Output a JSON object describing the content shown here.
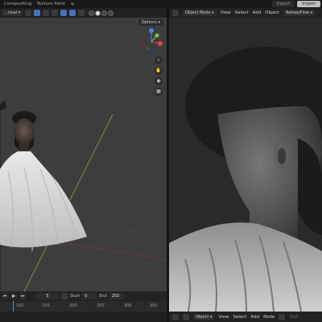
{
  "workspace_tabs": [
    "Compositing",
    "Texture Paint"
  ],
  "workspace_add": "+",
  "top_right": {
    "export_label": "Export",
    "import_label": "Import"
  },
  "left_header": {
    "mode_label": "...rmal ▾",
    "options_label": "Options ▾"
  },
  "right_header": {
    "mode_label": "Object Mode ▾",
    "menus": [
      "View",
      "Select",
      "Add",
      "Object"
    ],
    "addon_label": "RetopoFlow ▾"
  },
  "nav_icons": [
    "zoom-icon",
    "hand-icon",
    "camera-icon",
    "grid-icon"
  ],
  "timeline": {
    "frame_current": "5",
    "start_label": "Start",
    "start_value": "0",
    "end_label": "End",
    "end_value": "250",
    "ruler_ticks": [
      "100",
      "150",
      "200",
      "250",
      "300",
      "350"
    ]
  },
  "right_footer": {
    "mode_label": "Object ▾",
    "menus": [
      "View",
      "Select",
      "Add",
      "Node"
    ],
    "slot_label": "Slot"
  },
  "colors": {
    "gizmo_x": "#e0454f",
    "gizmo_y": "#7ac943",
    "gizmo_z": "#4a84e0",
    "playhead": "#5e8fe0"
  }
}
